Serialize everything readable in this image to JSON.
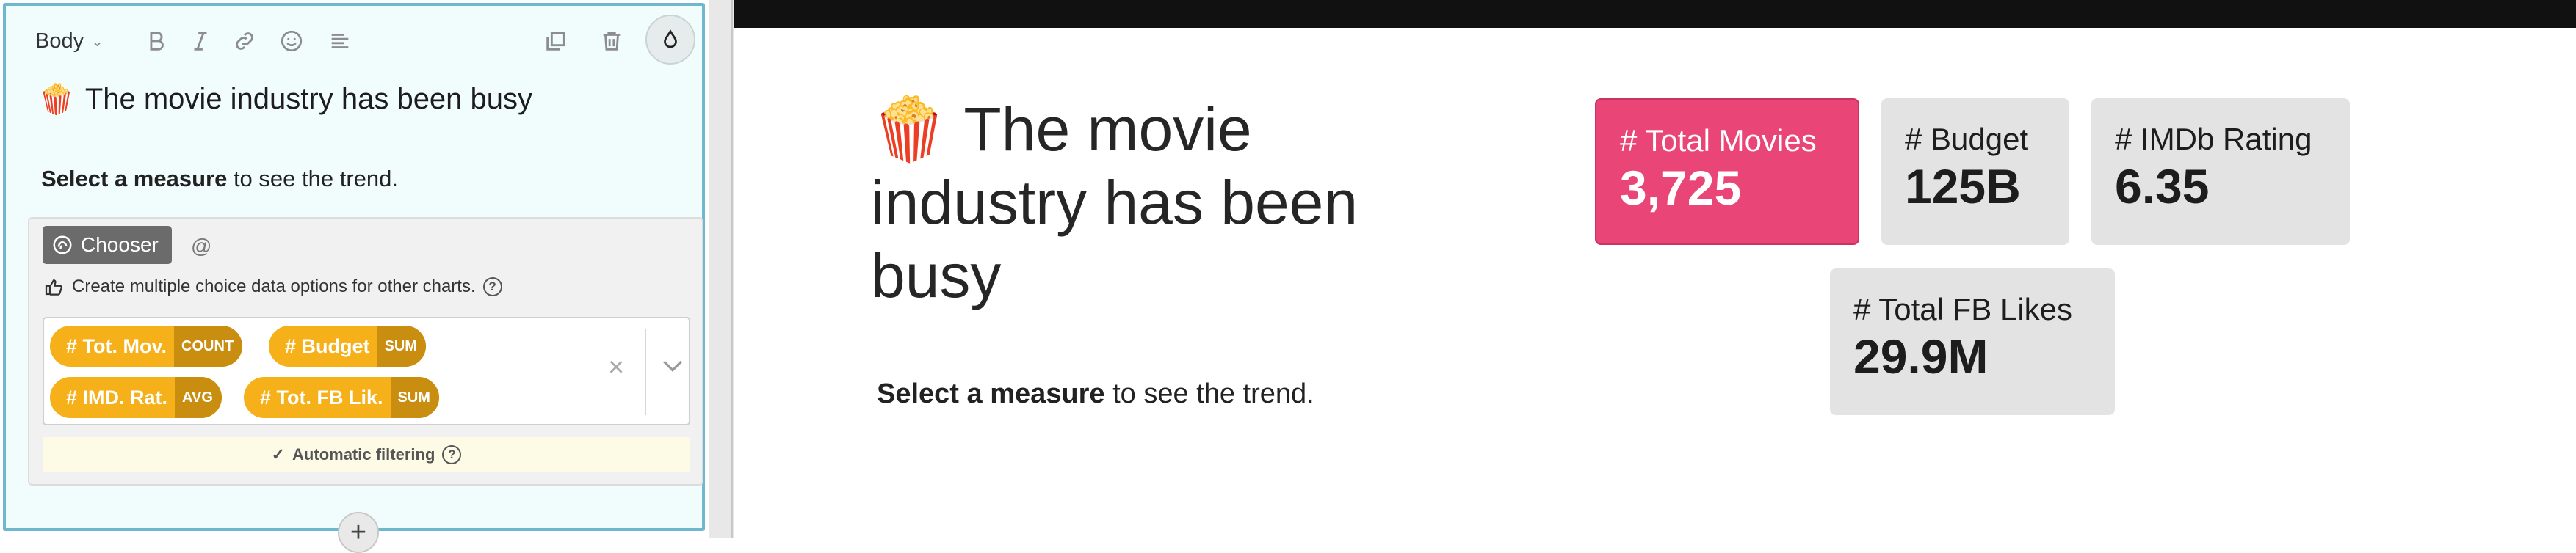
{
  "editor": {
    "style_label": "Body",
    "title_emoji": "🍿",
    "title": "The movie industry has been busy",
    "subtitle_bold": "Select a measure",
    "subtitle_rest": " to see the trend.",
    "chooser_label": "Chooser",
    "at_sign": "@",
    "hint": "Create multiple choice data options for other charts.",
    "chips": [
      {
        "label": "# Tot. Mov.",
        "agg": "COUNT"
      },
      {
        "label": "# Budget",
        "agg": "SUM"
      },
      {
        "label": "# IMD. Rat.",
        "agg": "AVG"
      },
      {
        "label": "# Tot. FB Lik.",
        "agg": "SUM"
      }
    ],
    "auto_filter_label": "Automatic filtering",
    "add_label": "+"
  },
  "preview": {
    "title_emoji": "🍿",
    "title": "The movie industry has been busy",
    "subtitle_bold": "Select a measure",
    "subtitle_rest": " to see the trend.",
    "kpis": [
      {
        "name": "# Total Movies",
        "value": "3,725",
        "active": true
      },
      {
        "name": "# Budget",
        "value": "125B",
        "active": false
      },
      {
        "name": "# IMDb Rating",
        "value": "6.35",
        "active": false
      },
      {
        "name": "# Total FB Likes",
        "value": "29.9M",
        "active": false
      }
    ]
  },
  "colors": {
    "accent_pink": "#e94677",
    "chip_yellow": "#f5b01a",
    "editor_border": "#6fb6cf"
  },
  "icons": [
    "chevron-down-icon",
    "bold-icon",
    "italic-icon",
    "link-icon",
    "emoji-icon",
    "align-icon",
    "duplicate-icon",
    "trash-icon",
    "water-drop-icon",
    "chooser-icon",
    "pointing-hand-icon",
    "help-icon",
    "close-icon",
    "check-icon",
    "plus-icon"
  ]
}
